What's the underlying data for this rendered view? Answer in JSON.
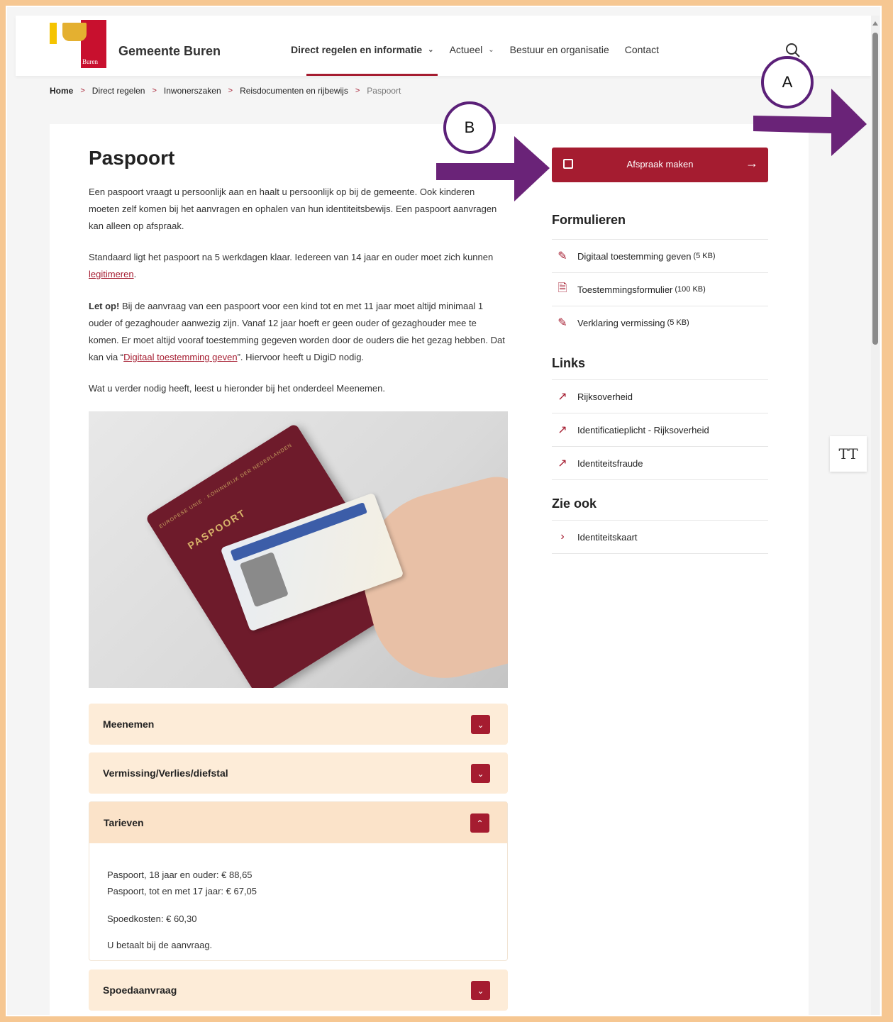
{
  "header": {
    "brand": "Gemeente Buren",
    "logo_text": "Buren",
    "nav": [
      {
        "label": "Direct regelen en informatie",
        "has_dropdown": true,
        "active": true
      },
      {
        "label": "Actueel",
        "has_dropdown": true,
        "active": false
      },
      {
        "label": "Bestuur en organisatie",
        "has_dropdown": false,
        "active": false
      },
      {
        "label": "Contact",
        "has_dropdown": false,
        "active": false
      }
    ],
    "search_icon": "search-icon"
  },
  "breadcrumb": [
    "Home",
    "Direct regelen",
    "Inwonerszaken",
    "Reisdocumenten en rijbewijs",
    "Paspoort"
  ],
  "main": {
    "title": "Paspoort",
    "p1": "Een paspoort vraagt u persoonlijk aan en haalt u persoonlijk op bij de gemeente. Ook kinderen moeten zelf komen bij het aanvragen en ophalen van hun identiteitsbewijs. Een paspoort aanvragen kan alleen op afspraak.",
    "p2_before": "Standaard ligt het paspoort na 5 werkdagen klaar. Iedereen van 14 jaar en ouder moet zich kunnen ",
    "p2_link": "legitimeren",
    "p2_after": ".",
    "p3_bold": "Let op!",
    "p3_before": " Bij de aanvraag van een paspoort voor een kind tot en met 11 jaar moet altijd minimaal 1 ouder of gezaghouder aanwezig zijn. Vanaf 12 jaar hoeft er geen ouder of gezaghouder mee te komen. Er moet altijd vooraf toestemming gegeven worden door de ouders die het gezag hebben. Dat kan via “",
    "p3_link": "Digitaal toestemming geven",
    "p3_after": "”. Hiervoor heeft u DigiD nodig.",
    "p4": "Wat u verder nodig heeft, leest u hieronder bij het onderdeel Meenemen.",
    "photo": {
      "passport_title": "PASPOORT",
      "passport_sub": "EUROPESE UNIE · KONINKRIJK DER NEDERLANDEN"
    },
    "accordions": [
      {
        "label": "Meenemen",
        "open": false
      },
      {
        "label": "Vermissing/Verlies/diefstal",
        "open": false
      },
      {
        "label": "Tarieven",
        "open": true
      },
      {
        "label": "Spoedaanvraag",
        "open": false
      }
    ],
    "tarieven_body": [
      "Paspoort, 18 jaar en ouder: € 88,65",
      "Paspoort, tot en met 17 jaar: € 67,05",
      "Spoedkosten: € 60,30",
      "U betaalt bij de aanvraag."
    ]
  },
  "sidebar": {
    "cta_label": "Afspraak maken",
    "cta_arrow": "→",
    "formulieren_heading": "Formulieren",
    "formulieren": [
      {
        "label": "Digitaal toestemming geven",
        "size": "(5 KB)",
        "icon": "signature-icon"
      },
      {
        "label": "Toestemmingsformulier",
        "size": "(100 KB)",
        "icon": "pdf-icon"
      },
      {
        "label": "Verklaring vermissing",
        "size": "(5 KB)",
        "icon": "signature-icon"
      }
    ],
    "links_heading": "Links",
    "links": [
      {
        "label": "Rijksoverheid",
        "icon": "external-link-icon"
      },
      {
        "label": "Identificatieplicht - Rijksoverheid",
        "icon": "external-link-icon"
      },
      {
        "label": "Identiteitsfraude",
        "icon": "external-link-icon"
      }
    ],
    "zie_ook_heading": "Zie ook",
    "zie_ook": [
      {
        "label": "Identiteitskaart",
        "icon": "chevron-right-icon"
      }
    ]
  },
  "tools": {
    "font_size_label": "TT"
  },
  "annotations": {
    "marker_a": "A",
    "marker_b": "B",
    "arrow_color": "#6a2378"
  },
  "colors": {
    "accent": "#a51c30",
    "accordion_bg": "#fdecd8",
    "page_border": "#f6c792"
  }
}
